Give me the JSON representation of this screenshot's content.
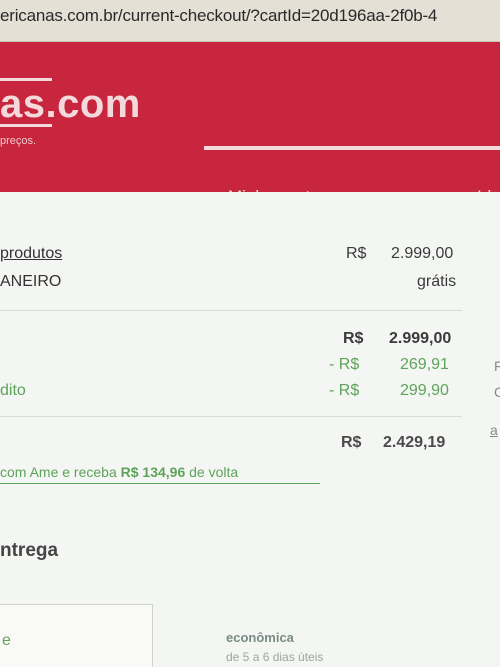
{
  "browser": {
    "url": "ericanas.com.br/current-checkout/?cartId=20d196aa-2f0b-4"
  },
  "header": {
    "logo_text": "as.com",
    "tagline": "preços.",
    "steps": {
      "current": "Minha cesta",
      "next": "Ide"
    },
    "colors": {
      "brand": "#c7263e",
      "accent_green": "#5ea35a"
    }
  },
  "summary": {
    "products_label": "produtos",
    "products_currency": "R$",
    "products_value": "2.999,00",
    "shipping_label": "ANEIRO",
    "shipping_value": "grátis",
    "subtotal_currency": "R$",
    "subtotal_value": "2.999,00",
    "discount1_currency": "- R$",
    "discount1_value": "269,91",
    "discount2_label": "dito",
    "discount2_currency": "- R$",
    "discount2_value": "299,90",
    "total_currency": "R$",
    "total_value": "2.429,19",
    "right_edge_1": "F",
    "right_edge_2": "C",
    "right_edge_link": "a"
  },
  "cashback": {
    "prefix": "com Ame e receba ",
    "amount": "R$ 134,96",
    "suffix": " de volta"
  },
  "delivery": {
    "title": "ntrega",
    "option_letter": "e",
    "option_name": "econômica",
    "option_detail": "de 5 a 6 dias úteis"
  }
}
